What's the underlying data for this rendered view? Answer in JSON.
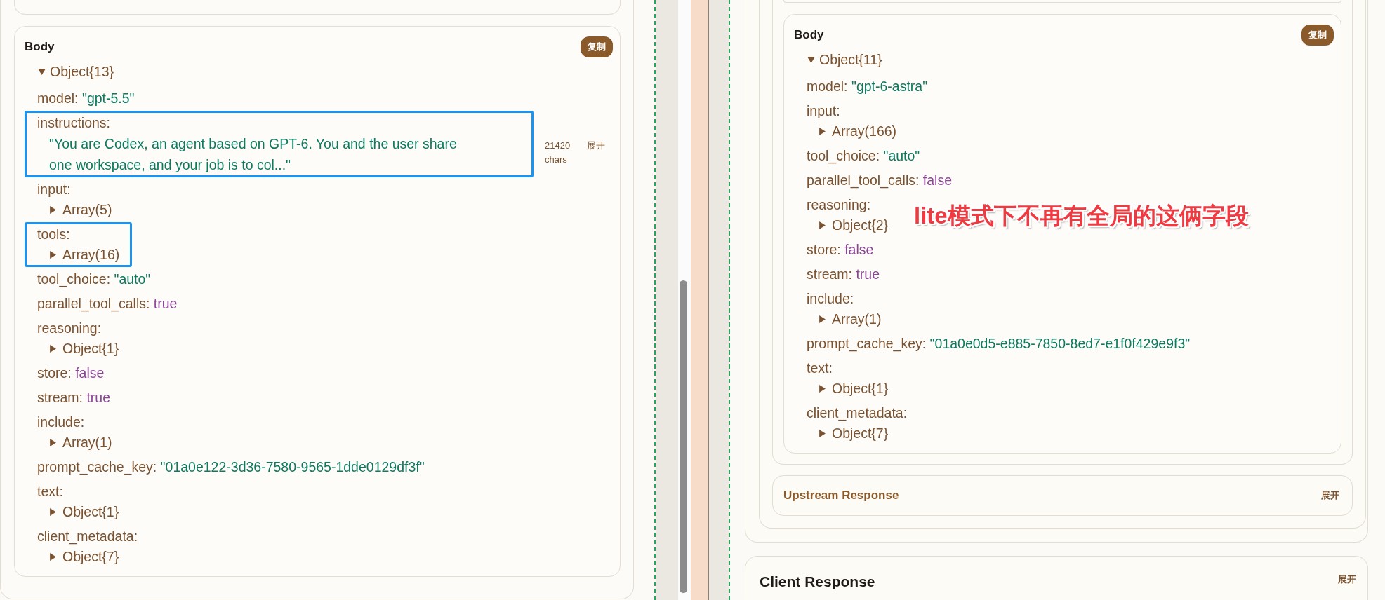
{
  "left_panel": {
    "body": {
      "title": "Body",
      "copy_button": "复制",
      "root": {
        "label": "Object{13}",
        "expanded": true
      },
      "fields": [
        {
          "kind": "string",
          "key": "model:",
          "value": "\"gpt-5.5\"",
          "highlighted": false
        },
        {
          "kind": "long_string",
          "key": "instructions:",
          "value": "\"You are Codex, an agent based on GPT-6. You and the user share one workspace, and your job is to col...\"",
          "highlighted": true,
          "meta": {
            "count": "21420 chars",
            "toggle": "展开"
          }
        },
        {
          "kind": "nested",
          "key": "input:",
          "child": {
            "label": "Array(5)",
            "expanded": false
          },
          "highlighted": false
        },
        {
          "kind": "nested",
          "key": "tools:",
          "child": {
            "label": "Array(16)",
            "expanded": false
          },
          "highlighted": true
        },
        {
          "kind": "string",
          "key": "tool_choice:",
          "value": "\"auto\"",
          "highlighted": false
        },
        {
          "kind": "boolean",
          "key": "parallel_tool_calls:",
          "value": "true",
          "highlighted": false
        },
        {
          "kind": "nested",
          "key": "reasoning:",
          "child": {
            "label": "Object{1}",
            "expanded": false
          },
          "highlighted": false
        },
        {
          "kind": "boolean",
          "key": "store:",
          "value": "false",
          "highlighted": false
        },
        {
          "kind": "boolean",
          "key": "stream:",
          "value": "true",
          "highlighted": false
        },
        {
          "kind": "nested",
          "key": "include:",
          "child": {
            "label": "Array(1)",
            "expanded": false
          },
          "highlighted": false
        },
        {
          "kind": "string",
          "key": "prompt_cache_key:",
          "value": "\"01a0e122-3d36-7580-9565-1dde0129df3f\"",
          "highlighted": false
        },
        {
          "kind": "nested",
          "key": "text:",
          "child": {
            "label": "Object{1}",
            "expanded": false
          },
          "highlighted": false
        },
        {
          "kind": "nested",
          "key": "client_metadata:",
          "child": {
            "label": "Object{7}",
            "expanded": false
          },
          "highlighted": false
        }
      ]
    }
  },
  "right_panel": {
    "body": {
      "title": "Body",
      "copy_button": "复制",
      "root": {
        "label": "Object{11}",
        "expanded": true
      },
      "fields": [
        {
          "kind": "string",
          "key": "model:",
          "value": "\"gpt-6-astra\"",
          "highlighted": false
        },
        {
          "kind": "nested",
          "key": "input:",
          "child": {
            "label": "Array(166)",
            "expanded": false
          },
          "highlighted": false
        },
        {
          "kind": "string",
          "key": "tool_choice:",
          "value": "\"auto\"",
          "highlighted": false
        },
        {
          "kind": "boolean",
          "key": "parallel_tool_calls:",
          "value": "false",
          "highlighted": false
        },
        {
          "kind": "nested",
          "key": "reasoning:",
          "child": {
            "label": "Object{2}",
            "expanded": false
          },
          "highlighted": false
        },
        {
          "kind": "boolean",
          "key": "store:",
          "value": "false",
          "highlighted": false
        },
        {
          "kind": "boolean",
          "key": "stream:",
          "value": "true",
          "highlighted": false
        },
        {
          "kind": "nested",
          "key": "include:",
          "child": {
            "label": "Array(1)",
            "expanded": false
          },
          "highlighted": false
        },
        {
          "kind": "string",
          "key": "prompt_cache_key:",
          "value": "\"01a0e0d5-e885-7850-8ed7-e1f0f429e9f3\"",
          "highlighted": false
        },
        {
          "kind": "nested",
          "key": "text:",
          "child": {
            "label": "Object{1}",
            "expanded": false
          },
          "highlighted": false
        },
        {
          "kind": "nested",
          "key": "client_metadata:",
          "child": {
            "label": "Object{7}",
            "expanded": false
          },
          "highlighted": false
        }
      ]
    },
    "upstream_response": {
      "title": "Upstream Response",
      "toggle": "展开"
    }
  },
  "client_response": {
    "title": "Client Response",
    "toggle": "展开"
  },
  "annotation": {
    "text": "lite模式下不再有全局的这俩字段"
  }
}
